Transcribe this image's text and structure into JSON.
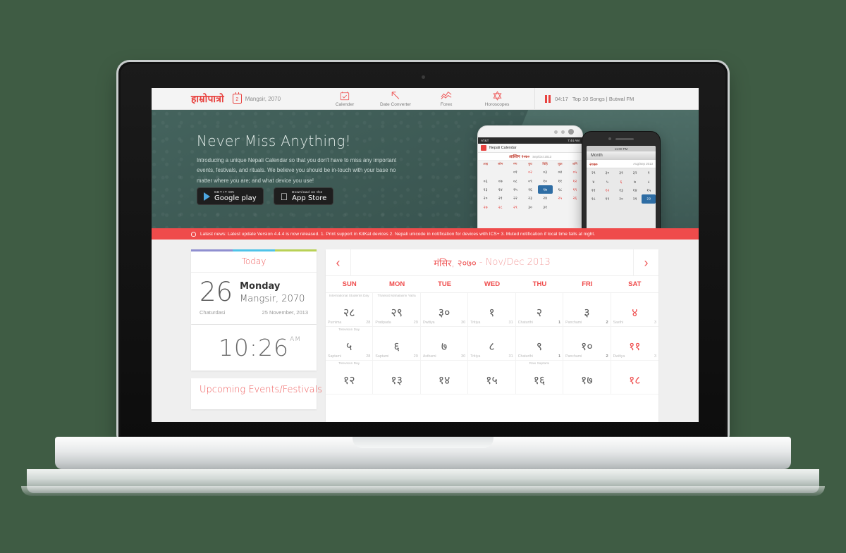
{
  "header": {
    "logo": "हाम्रोपात्रो",
    "date_badge_number": "2",
    "date_text": "Mangsir, 2070",
    "nav": [
      {
        "label": "Calender",
        "icon": "calendar-check-icon"
      },
      {
        "label": "Date Converter",
        "icon": "arrow-up-left-icon"
      },
      {
        "label": "Forex",
        "icon": "line-chart-icon"
      },
      {
        "label": "Horoscopes",
        "icon": "star-hexagram-icon"
      }
    ],
    "player": {
      "icon": "pause-icon",
      "time": "04:17",
      "title": "Top 10 Songs | Butwal FM"
    }
  },
  "hero": {
    "title": "Never Miss Anything!",
    "subtitle": "Introducing a unique Nepali Calendar so that you don't have to miss any important events, festivals, and rituals. We believe you should be in-touch with your base no matter where you are; and what device you use!",
    "badges": [
      {
        "small": "GET IT ON",
        "big": "Google play",
        "icon": "google-play-icon"
      },
      {
        "small": "Download on the",
        "big": "App Store",
        "icon": "apple-icon"
      }
    ],
    "phone_android": {
      "carrier": "AT&T",
      "clock": "7:44 AM",
      "app_title": "Nepali Calendar",
      "month_np": "आश्विन २०७०",
      "month_en": "Sep/Oct 2013",
      "day_headers": [
        "आइ",
        "सोम",
        "मंग",
        "बुध",
        "बिहि",
        "शुक्र",
        "शनि"
      ],
      "cells": [
        {
          "t": "",
          "r": false
        },
        {
          "t": "",
          "r": false
        },
        {
          "t": "०१",
          "r": false
        },
        {
          "t": "०२",
          "r": true
        },
        {
          "t": "०३",
          "r": false
        },
        {
          "t": "०४",
          "r": false
        },
        {
          "t": "०५",
          "r": true
        },
        {
          "t": "०६",
          "r": false
        },
        {
          "t": "०७",
          "r": false
        },
        {
          "t": "०८",
          "r": false
        },
        {
          "t": "०९",
          "r": false
        },
        {
          "t": "१०",
          "r": false
        },
        {
          "t": "११",
          "r": false
        },
        {
          "t": "१२",
          "r": true
        },
        {
          "t": "१३",
          "r": false
        },
        {
          "t": "१४",
          "r": false
        },
        {
          "t": "१५",
          "r": false
        },
        {
          "t": "१६",
          "r": false
        },
        {
          "t": "१७",
          "r": false,
          "sel": true
        },
        {
          "t": "१८",
          "r": false
        },
        {
          "t": "१९",
          "r": true
        },
        {
          "t": "२०",
          "r": false
        },
        {
          "t": "२१",
          "r": false
        },
        {
          "t": "२२",
          "r": false
        },
        {
          "t": "२३",
          "r": false
        },
        {
          "t": "२४",
          "r": false
        },
        {
          "t": "२५",
          "r": true
        },
        {
          "t": "२६",
          "r": true
        },
        {
          "t": "२७",
          "r": true
        },
        {
          "t": "२८",
          "r": true
        },
        {
          "t": "२९",
          "r": true
        },
        {
          "t": "३०",
          "r": false
        },
        {
          "t": "३१",
          "r": false
        },
        {
          "t": "",
          "r": false
        },
        {
          "t": "",
          "r": false
        }
      ]
    },
    "phone_ios": {
      "clock": "11:00 PM",
      "nav_title": "Month",
      "month_np": "२०७०",
      "month_en": "Aug/Sep 2013",
      "cells": [
        {
          "t": "२९",
          "r": false
        },
        {
          "t": "३०",
          "r": false
        },
        {
          "t": "३१",
          "r": false
        },
        {
          "t": "३२",
          "r": false
        },
        {
          "t": "१",
          "r": false
        },
        {
          "t": "४",
          "r": false
        },
        {
          "t": "५",
          "r": false
        },
        {
          "t": "६",
          "r": true
        },
        {
          "t": "७",
          "r": false
        },
        {
          "t": "८",
          "r": false
        },
        {
          "t": "११",
          "r": false
        },
        {
          "t": "१२",
          "r": true
        },
        {
          "t": "१३",
          "r": false
        },
        {
          "t": "१४",
          "r": false
        },
        {
          "t": "१५",
          "r": false
        },
        {
          "t": "१८",
          "r": false
        },
        {
          "t": "१९",
          "r": false
        },
        {
          "t": "२०",
          "r": false
        },
        {
          "t": "२१",
          "r": false
        },
        {
          "t": "२२",
          "r": false,
          "sel": true
        }
      ]
    }
  },
  "ticker": {
    "icon": "bell-icon",
    "text": "Latest news: Latest update Version 4.4.4 is now released. 1. Print support in KitKat devices 2. Nepali unicode in notification for devices with ICS+ 3. Muted notification if local time falls at night."
  },
  "today": {
    "heading": "Today",
    "day_number": "26",
    "weekday": "Monday",
    "nepali_date": "Mangsir, 2070",
    "tithi": "Chaturdasi",
    "english_date": "25 November, 2013",
    "stripe_colors": [
      "#8f8fd0",
      "#4fc3e8",
      "#b9d156"
    ],
    "clock_time": "10:26",
    "clock_meridiem": "AM"
  },
  "events_card": {
    "title": "Upcoming Events/Festivals"
  },
  "calendar": {
    "prev_icon": "chevron-left-icon",
    "next_icon": "chevron-right-icon",
    "title_np": "मंसिर, २०७०",
    "title_sep": "-",
    "title_en": "Nov/Dec 2013",
    "day_headers": [
      "SUN",
      "MON",
      "TUE",
      "WED",
      "THU",
      "FRI",
      "SAT"
    ],
    "weeks": [
      [
        {
          "event": "International Students Day",
          "np": "२८",
          "tithi": "Purnima",
          "eng": "28",
          "red": false
        },
        {
          "event": "Thankot Mahalaxmi Yatra",
          "np": "२९",
          "tithi": "Pratipada",
          "eng": "29",
          "red": false
        },
        {
          "event": "",
          "np": "३०",
          "tithi": "Dwitiya",
          "eng": "30",
          "red": false
        },
        {
          "event": "",
          "np": "१",
          "tithi": "Tritiya",
          "eng": "31",
          "red": false
        },
        {
          "event": "",
          "np": "२",
          "tithi": "Chaturthi",
          "eng": "1",
          "red": false,
          "bold": true
        },
        {
          "event": "",
          "np": "३",
          "tithi": "Panchami",
          "eng": "2",
          "red": false,
          "bold": true
        },
        {
          "event": "",
          "np": "४",
          "tithi": "Sasthi",
          "eng": "3",
          "red": true
        }
      ],
      [
        {
          "event": "Televison Day",
          "np": "५",
          "tithi": "Saptami",
          "eng": "28",
          "red": false
        },
        {
          "event": "",
          "np": "६",
          "tithi": "Saptami",
          "eng": "29",
          "red": false
        },
        {
          "event": "",
          "np": "७",
          "tithi": "Asthami",
          "eng": "30",
          "red": false
        },
        {
          "event": "",
          "np": "८",
          "tithi": "Tritiya",
          "eng": "31",
          "red": false
        },
        {
          "event": "",
          "np": "९",
          "tithi": "Chaturthi",
          "eng": "1",
          "red": false,
          "bold": true
        },
        {
          "event": "",
          "np": "१०",
          "tithi": "Panchami",
          "eng": "2",
          "red": false,
          "bold": true
        },
        {
          "event": "",
          "np": "११",
          "tithi": "Dwitiya",
          "eng": "3",
          "red": true
        }
      ],
      [
        {
          "event": "Televison Day",
          "np": "१२",
          "tithi": "",
          "eng": "",
          "red": false
        },
        {
          "event": "",
          "np": "१३",
          "tithi": "",
          "eng": "",
          "red": false
        },
        {
          "event": "",
          "np": "१४",
          "tithi": "",
          "eng": "",
          "red": false
        },
        {
          "event": "",
          "np": "१५",
          "tithi": "",
          "eng": "",
          "red": false
        },
        {
          "event": "Ravi Saptami",
          "np": "१६",
          "tithi": "",
          "eng": "",
          "red": false
        },
        {
          "event": "",
          "np": "१७",
          "tithi": "",
          "eng": "",
          "red": false
        },
        {
          "event": "",
          "np": "१८",
          "tithi": "",
          "eng": "",
          "red": true
        }
      ]
    ]
  }
}
